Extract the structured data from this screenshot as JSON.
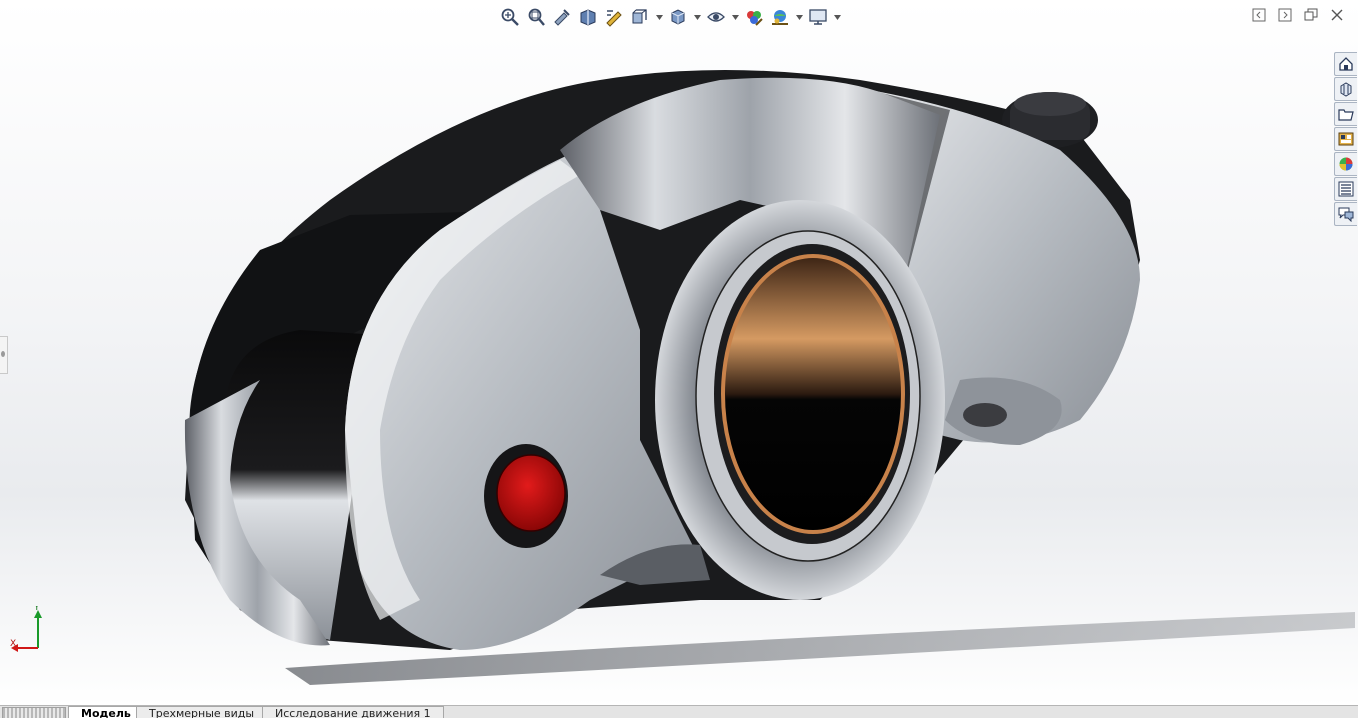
{
  "hud_toolbar": {
    "items": [
      {
        "icon": "zoom-to-fit-icon",
        "dropdown": false
      },
      {
        "icon": "zoom-to-area-icon",
        "dropdown": false
      },
      {
        "icon": "previous-view-icon",
        "dropdown": false
      },
      {
        "icon": "section-view-icon",
        "dropdown": false
      },
      {
        "icon": "dynamic-annotation-views-icon",
        "dropdown": false
      },
      {
        "icon": "view-orientation-icon",
        "dropdown": true
      },
      {
        "icon": "display-style-icon",
        "dropdown": true
      },
      {
        "icon": "hide-show-items-icon",
        "dropdown": true
      },
      {
        "icon": "edit-appearance-icon",
        "dropdown": false
      },
      {
        "icon": "apply-scene-icon",
        "dropdown": true
      },
      {
        "icon": "view-settings-icon",
        "dropdown": true
      }
    ]
  },
  "window_controls": [
    "tile-left-icon",
    "tile-right-icon",
    "restore-icon",
    "close-icon"
  ],
  "task_pane": {
    "tabs": [
      {
        "icon": "solidworks-resources-icon"
      },
      {
        "icon": "design-library-icon"
      },
      {
        "icon": "file-explorer-icon"
      },
      {
        "icon": "view-palette-icon"
      },
      {
        "icon": "appearances-scenes-icon"
      },
      {
        "icon": "custom-properties-icon"
      },
      {
        "icon": "forum-icon"
      }
    ]
  },
  "triad": {
    "x_label": "X",
    "y_label": "Y"
  },
  "bottom_tabs": [
    {
      "label": "Модель",
      "active": true
    },
    {
      "label": "Трехмерные виды",
      "active": false
    },
    {
      "label": "Исследование движения 1",
      "active": false
    }
  ],
  "colors": {
    "accent_red": "#c00d0d",
    "bronze": "#c8824a",
    "chrome": "#b8bcc2",
    "dark_metal": "#1c1c1e",
    "triad_x": "#d01818",
    "triad_y": "#1a9a2a"
  }
}
